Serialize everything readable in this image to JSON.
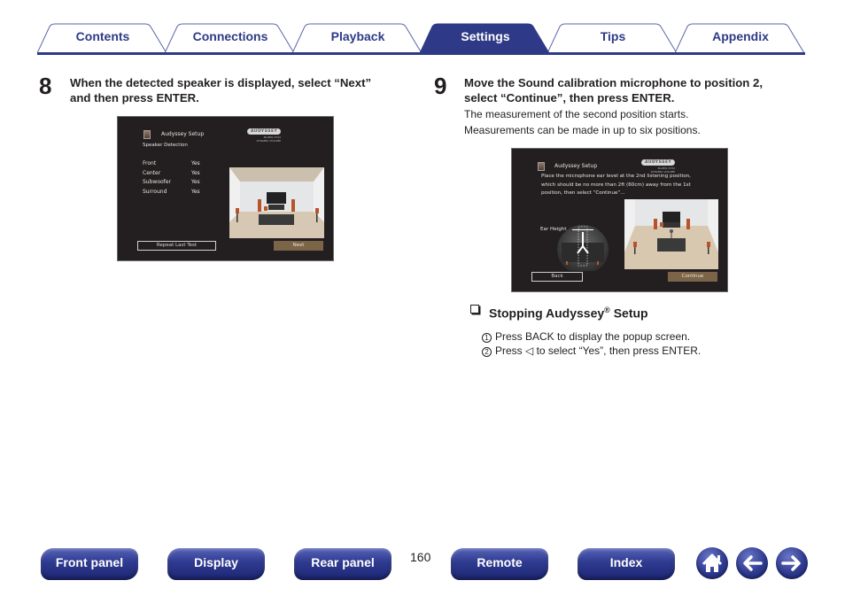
{
  "tabs": [
    {
      "label": "Contents",
      "active": false
    },
    {
      "label": "Connections",
      "active": false
    },
    {
      "label": "Playback",
      "active": false
    },
    {
      "label": "Settings",
      "active": true
    },
    {
      "label": "Tips",
      "active": false
    },
    {
      "label": "Appendix",
      "active": false
    }
  ],
  "colors": {
    "brand": "#2e3a87",
    "screen_bg": "#231f20",
    "screen_button": "#7b6447"
  },
  "step8": {
    "number": "8",
    "title_line1": "When the detected speaker is displayed, select “Next”",
    "title_line2": "and then press ENTER.",
    "screen": {
      "header": "Audyssey Setup",
      "logo": "AUDYSSEY",
      "logo_sub1": "MultEQ XT32",
      "logo_sub2": "DYNAMIC VOLUME",
      "subtitle": "Speaker Detection",
      "rows": [
        {
          "label": "Front",
          "value": "Yes"
        },
        {
          "label": "Center",
          "value": "Yes"
        },
        {
          "label": "Subwoofer",
          "value": "Yes"
        },
        {
          "label": "Surround",
          "value": "Yes"
        }
      ],
      "button_left": "Repeat Last Test",
      "button_right": "Next"
    }
  },
  "step9": {
    "number": "9",
    "title_line1": "Move the Sound calibration microphone to position 2,",
    "title_line2": "select “Continue”, then press ENTER.",
    "body_line1": "The measurement of the second position starts.",
    "body_line2": "Measurements can be made in up to six positions.",
    "screen": {
      "header": "Audyssey Setup",
      "logo": "AUDYSSEY",
      "logo_sub1": "MultEQ XT32",
      "logo_sub2": "DYNAMIC VOLUME",
      "msg_line1": "Place the microphone ear level at the 2nd listening position,",
      "msg_line2": "which should be no more than 2ft (60cm) away from the 1st",
      "msg_line3": "position, then select “Continue”...",
      "ear_height": "Ear Height",
      "button_left": "Back",
      "button_right": "Continue"
    }
  },
  "stopping": {
    "title": "Stopping Audyssey",
    "reg": "®",
    "title_suffix": " Setup",
    "steps": [
      {
        "num": "1",
        "text": "Press BACK to display the popup screen."
      },
      {
        "num": "2",
        "text": "Press ◁ to select “Yes”, then press ENTER."
      }
    ]
  },
  "bottom_nav": {
    "buttons": [
      "Front panel",
      "Display",
      "Rear panel",
      "Remote",
      "Index"
    ],
    "page_number": "160",
    "icons": [
      "home-icon",
      "back-arrow-icon",
      "forward-arrow-icon"
    ]
  }
}
